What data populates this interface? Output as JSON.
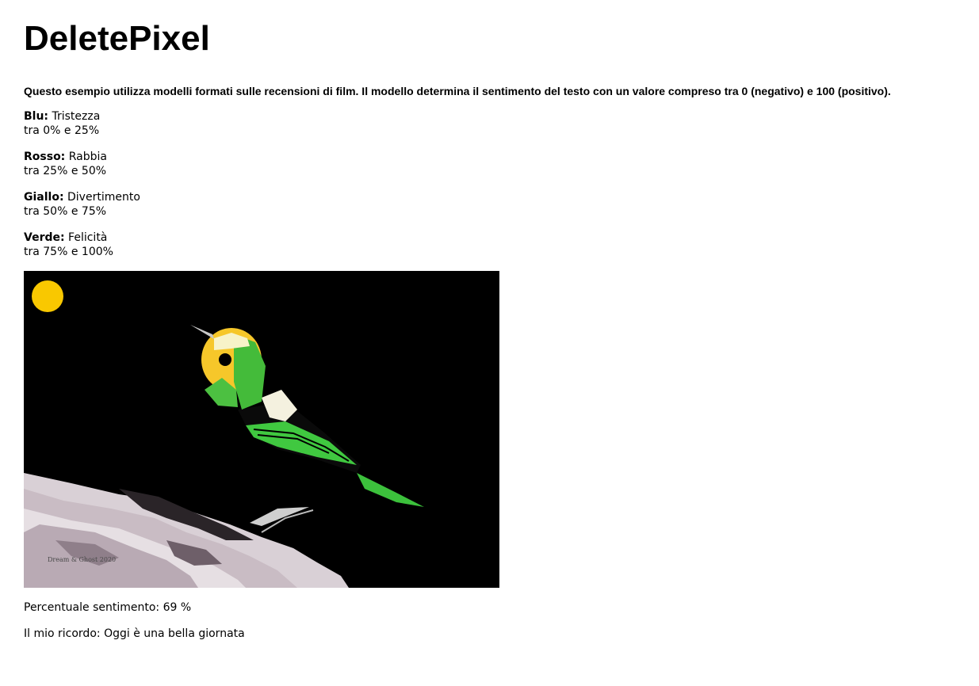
{
  "page": {
    "title": "DeletePixel",
    "intro": "Questo esempio utilizza modelli formati sulle recensioni di film. Il modello determina il sentimento del testo con un valore compreso tra 0 (negativo) e 100 (positivo)."
  },
  "legend": [
    {
      "color_name": "Blu:",
      "emotion": "Tristezza",
      "range": "tra 0% e 25%"
    },
    {
      "color_name": "Rosso:",
      "emotion": "Rabbia",
      "range": "tra 25% e 50%"
    },
    {
      "color_name": "Giallo:",
      "emotion": "Divertimento",
      "range": "tra 50% e 75%"
    },
    {
      "color_name": "Verde:",
      "emotion": "Felicità",
      "range": "tra 75% e 100%"
    }
  ],
  "image": {
    "subject": "bird-on-branch",
    "indicator_color": "#f9c800",
    "signature": "Dream & Ghost 2020"
  },
  "result": {
    "percent_label": "Percentuale sentimento:",
    "percent_value": "69",
    "percent_unit": "%",
    "memory_label": "Il mio ricordo:",
    "memory_text": "Oggi è una bella giornata"
  }
}
